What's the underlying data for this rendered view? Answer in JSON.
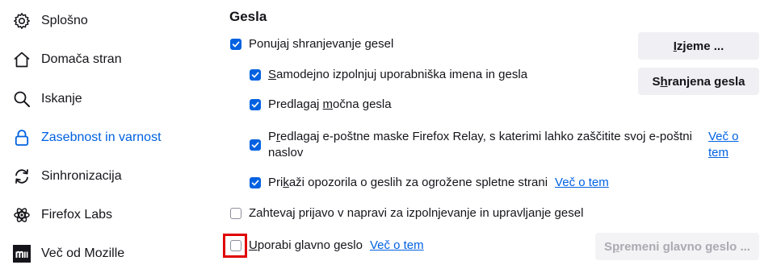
{
  "sidebar": {
    "items": [
      {
        "label": "Splošno",
        "icon": "gear-icon"
      },
      {
        "label": "Domača stran",
        "icon": "home-icon"
      },
      {
        "label": "Iskanje",
        "icon": "search-icon"
      },
      {
        "label": "Zasebnost in varnost",
        "icon": "lock-icon",
        "selected": true
      },
      {
        "label": "Sinhronizacija",
        "icon": "sync-icon"
      },
      {
        "label": "Firefox Labs",
        "icon": "flask-icon"
      },
      {
        "label": "Več od Mozille",
        "icon": "mozilla-icon"
      }
    ]
  },
  "passwords": {
    "title": "Gesla",
    "offer_save": {
      "pre": "Ponu",
      "u": "j",
      "post": "aj shranjevanje gesel",
      "checked": true
    },
    "autofill": {
      "pre": "",
      "u": "S",
      "post": "amodejno izpolnjuj uporabniška imena in gesla",
      "checked": true
    },
    "suggest_strong": {
      "pre": "Predlagaj ",
      "u": "m",
      "post": "očna gesla",
      "checked": true
    },
    "relay_line1": {
      "pre": "P",
      "u": "r",
      "post": "edlagaj e-poštne maske Firefox Relay, s katerimi lahko zaščitite svoj e-poštni"
    },
    "relay_line2": "naslov",
    "relay_checked": true,
    "relay_link_line1": "Več o",
    "relay_link_line2": "tem",
    "breach": {
      "pre": "Pri",
      "u": "k",
      "post": "aži opozorila o geslih za ogrožene spletne strani",
      "checked": true
    },
    "breach_link": "Več o tem",
    "require_login": {
      "label": "Zahtevaj prijavo v napravi za izpolnjevanje in upravljanje gesel",
      "checked": false
    },
    "primary": {
      "pre": "",
      "u": "U",
      "post": "porabi glavno geslo",
      "checked": false
    },
    "primary_link": "Več o tem",
    "exceptions_button": {
      "pre": "",
      "u": "I",
      "post": "zjeme ..."
    },
    "saved_button": {
      "pre": "S",
      "u": "h",
      "post": "ranjena gesla"
    },
    "change_primary_button": {
      "pre": "S",
      "u": "p",
      "post": "remeni glavno geslo ..."
    }
  },
  "colors": {
    "accent": "#0061e0",
    "highlight": "#e00000"
  }
}
